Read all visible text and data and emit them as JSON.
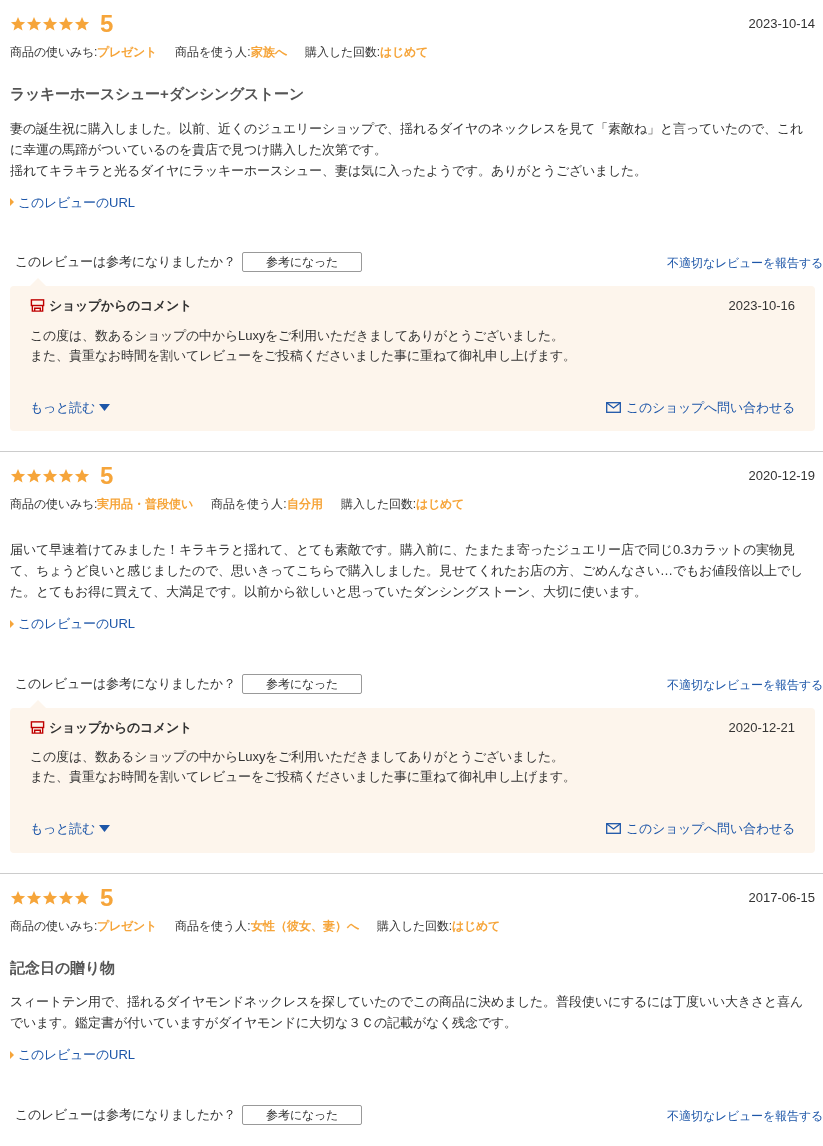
{
  "reviews": [
    {
      "stars": 5,
      "score": "5",
      "date": "2023-10-14",
      "meta": [
        {
          "label": "商品の使いみち:",
          "value": "プレゼント"
        },
        {
          "label": "商品を使う人:",
          "value": "家族へ"
        },
        {
          "label": "購入した回数:",
          "value": "はじめて"
        }
      ],
      "title": "ラッキーホースシュー+ダンシングストーン",
      "paragraphs": [
        "妻の誕生祝に購入しました。以前、近くのジュエリーショップで、揺れるダイヤのネックレスを見て「素敵ね」と言っていたので、これに幸運の馬蹄がついているのを貴店で見つけ購入した次第です。",
        "揺れてキラキラと光るダイヤにラッキーホースシュー、妻は気に入ったようです。ありがとうございました。"
      ],
      "url_link": "このレビューのURL",
      "helpful_question": "このレビューは参考になりましたか？",
      "helpful_button": "参考になった",
      "report_link": "不適切なレビューを報告する",
      "shop_comment": {
        "heading": "ショップからのコメント",
        "date": "2023-10-16",
        "lines": [
          "この度は、数あるショップの中からLuxyをご利用いただきましてありがとうございました。",
          "また、貴重なお時間を割いてレビューをご投稿くださいました事に重ねて御礼申し上げます。"
        ],
        "more_link": "もっと読む",
        "contact_link": "このショップへ問い合わせる"
      }
    },
    {
      "stars": 5,
      "score": "5",
      "date": "2020-12-19",
      "meta": [
        {
          "label": "商品の使いみち:",
          "value": "実用品・普段使い"
        },
        {
          "label": "商品を使う人:",
          "value": "自分用"
        },
        {
          "label": "購入した回数:",
          "value": "はじめて"
        }
      ],
      "paragraphs": [
        "届いて早速着けてみました！キラキラと揺れて、とても素敵です。購入前に、たまたま寄ったジュエリー店で同じ0.3カラットの実物見て、ちょうど良いと感じましたので、思いきってこちらで購入しました。見せてくれたお店の方、ごめんなさい…でもお値段倍以上でした。とてもお得に買えて、大満足です。以前から欲しいと思っていたダンシングストーン、大切に使います。"
      ],
      "url_link": "このレビューのURL",
      "helpful_question": "このレビューは参考になりましたか？",
      "helpful_button": "参考になった",
      "report_link": "不適切なレビューを報告する",
      "shop_comment": {
        "heading": "ショップからのコメント",
        "date": "2020-12-21",
        "lines": [
          "この度は、数あるショップの中からLuxyをご利用いただきましてありがとうございました。",
          "また、貴重なお時間を割いてレビューをご投稿くださいました事に重ねて御礼申し上げます。"
        ],
        "more_link": "もっと読む",
        "contact_link": "このショップへ問い合わせる"
      }
    },
    {
      "stars": 5,
      "score": "5",
      "date": "2017-06-15",
      "meta": [
        {
          "label": "商品の使いみち:",
          "value": "プレゼント"
        },
        {
          "label": "商品を使う人:",
          "value": "女性（彼女、妻）へ"
        },
        {
          "label": "購入した回数:",
          "value": "はじめて"
        }
      ],
      "title": "記念日の贈り物",
      "paragraphs": [
        "スィートテン用で、揺れるダイヤモンドネックレスを探していたのでこの商品に決めました。普段使いにするには丁度いい大きさと喜んでいます。鑑定書が付いていますがダイヤモンドに大切な３Ｃの記載がなく残念です。"
      ],
      "url_link": "このレビューのURL",
      "helpful_question": "このレビューは参考になりましたか？",
      "helpful_button": "参考になった",
      "report_link": "不適切なレビューを報告する"
    }
  ]
}
